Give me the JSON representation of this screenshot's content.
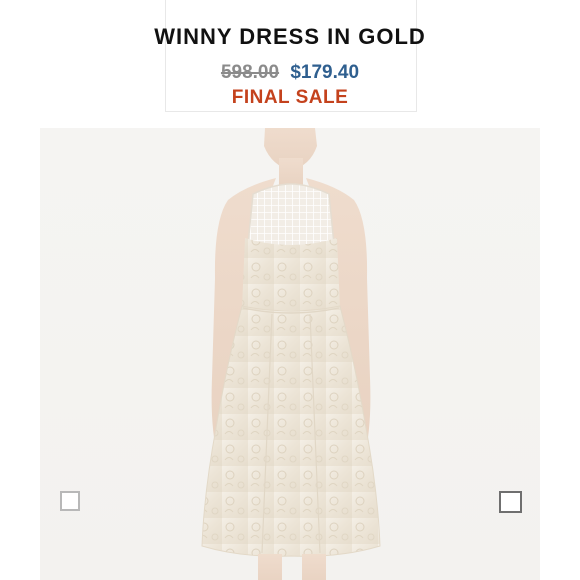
{
  "product": {
    "title": "WINNY DRESS IN GOLD",
    "original_price": "598.00",
    "sale_price": "$179.40",
    "sale_label": "FINAL SALE"
  },
  "colors": {
    "sale_price": "#2f5f8f",
    "final_sale": "#c4421d",
    "original_price": "#8b8b8b"
  }
}
